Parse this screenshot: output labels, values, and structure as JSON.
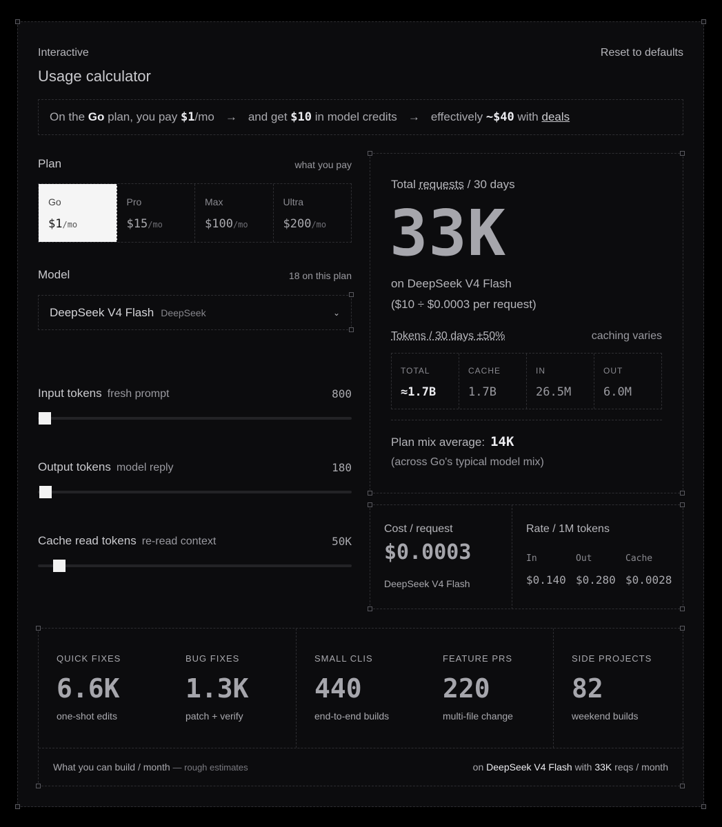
{
  "header": {
    "eyebrow": "Interactive",
    "title": "Usage calculator",
    "reset_label": "Reset to defaults"
  },
  "summary": {
    "p1": "On the",
    "plan": "Go",
    "p2": "plan, you pay",
    "price": "$1",
    "p3": "/mo",
    "arrow": "→",
    "p4": "and get",
    "credits": "$10",
    "p5": "in model credits",
    "p6": "effectively",
    "effective": "~$40",
    "p7": "with",
    "deals": "deals"
  },
  "plan_section": {
    "label": "Plan",
    "hint": "what you pay",
    "plans": [
      {
        "name": "Go",
        "price": "$1",
        "unit": "/mo"
      },
      {
        "name": "Pro",
        "price": "$15",
        "unit": "/mo"
      },
      {
        "name": "Max",
        "price": "$100",
        "unit": "/mo"
      },
      {
        "name": "Ultra",
        "price": "$200",
        "unit": "/mo"
      }
    ],
    "selected": "Go"
  },
  "model_section": {
    "label": "Model",
    "hint": "18 on this plan",
    "selected_model": "DeepSeek V4 Flash",
    "provider": "DeepSeek",
    "chevron": "⌄"
  },
  "sliders": [
    {
      "label": "Input tokens",
      "sub": "fresh prompt",
      "value": "800",
      "fraction": 0.022
    },
    {
      "label": "Output tokens",
      "sub": "model reply",
      "value": "180",
      "fraction": 0.024
    },
    {
      "label": "Cache read tokens",
      "sub": "re-read context",
      "value": "50K",
      "fraction": 0.068
    }
  ],
  "requests": {
    "label_a": "Total",
    "label_link": "requests",
    "label_b": "/ 30 days",
    "total": "33K",
    "on_model": "on DeepSeek V4 Flash",
    "formula": "($10 ÷ $0.0003 per request)"
  },
  "tokens": {
    "label": "Tokens / 30 days ±50%",
    "note": "caching varies",
    "cells": [
      {
        "label": "TOTAL",
        "value": "≈1.7B"
      },
      {
        "label": "CACHE",
        "value": "1.7B"
      },
      {
        "label": "IN",
        "value": "26.5M"
      },
      {
        "label": "OUT",
        "value": "6.0M"
      }
    ]
  },
  "mix": {
    "label": "Plan mix average:",
    "value": "14K",
    "sub": "(across Go's typical model mix)"
  },
  "cost": {
    "title": "Cost / request",
    "value": "$0.0003",
    "model": "DeepSeek V4 Flash"
  },
  "rates": {
    "title": "Rate / 1M tokens",
    "headers": [
      "In",
      "Out",
      "Cache"
    ],
    "values": [
      "$0.140",
      "$0.280",
      "$0.0028"
    ]
  },
  "builds": {
    "items": [
      {
        "label": "QUICK FIXES",
        "value": "6.6K",
        "sub": "one-shot edits"
      },
      {
        "label": "BUG FIXES",
        "value": "1.3K",
        "sub": "patch + verify"
      },
      {
        "label": "SMALL CLIS",
        "value": "440",
        "sub": "end-to-end builds"
      },
      {
        "label": "FEATURE PRS",
        "value": "220",
        "sub": "multi-file change"
      },
      {
        "label": "SIDE PROJECTS",
        "value": "82",
        "sub": "weekend builds"
      }
    ],
    "footer_left": "What you can build / month",
    "footer_left_muted": "— rough estimates",
    "footer_right_a": "on",
    "footer_right_model": "DeepSeek V4 Flash",
    "footer_right_b": "with",
    "footer_right_reqs": "33K",
    "footer_right_c": "reqs / month"
  }
}
